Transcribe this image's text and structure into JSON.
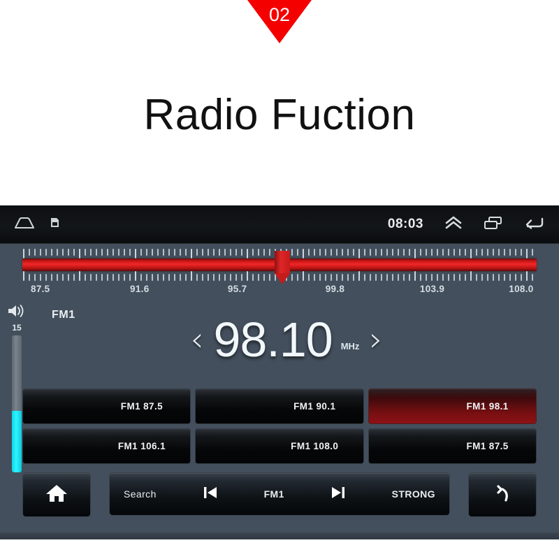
{
  "header": {
    "badge_number": "02",
    "title": "Radio Fuction"
  },
  "statusbar": {
    "home_icon": "home-outline-icon",
    "sd_icon": "sdcard-icon",
    "time": "08:03",
    "expand_icon": "double-chevron-up-icon",
    "recents_icon": "recent-apps-icon",
    "back_icon": "back-arrow-icon"
  },
  "tuner": {
    "marker_position_percent": 50.6,
    "scale_labels": [
      {
        "text": "87.5",
        "pos": 3.5
      },
      {
        "text": "91.6",
        "pos": 22.8
      },
      {
        "text": "95.7",
        "pos": 41.8
      },
      {
        "text": "99.8",
        "pos": 60.8
      },
      {
        "text": "103.9",
        "pos": 79.7
      },
      {
        "text": "108.0",
        "pos": 97.0
      }
    ]
  },
  "volume": {
    "icon": "speaker-volume-icon",
    "level_label": "15",
    "fill_percent": 45
  },
  "display": {
    "band_label": "FM1",
    "prev_chevron": "‹",
    "frequency": "98.10",
    "unit": "MHz",
    "next_chevron": "›"
  },
  "presets": [
    {
      "label": "FM1 87.5",
      "active": false
    },
    {
      "label": "FM1 90.1",
      "active": false
    },
    {
      "label": "FM1 98.1",
      "active": true
    },
    {
      "label": "FM1 106.1",
      "active": false
    },
    {
      "label": "FM1 108.0",
      "active": false
    },
    {
      "label": "FM1 87.5",
      "active": false
    }
  ],
  "bottom_bar": {
    "home_icon": "home-filled-icon",
    "search_label": "Search",
    "prev_icon": "skip-previous-icon",
    "band_label": "FM1",
    "next_icon": "skip-next-icon",
    "strong_label": "STRONG",
    "back_icon": "return-arrow-icon"
  },
  "colors": {
    "accent_red": "#f40000",
    "panel_bg": "#434f5c",
    "volume_cyan": "#2ef4ff",
    "tuner_bar_red": "#f02727"
  }
}
